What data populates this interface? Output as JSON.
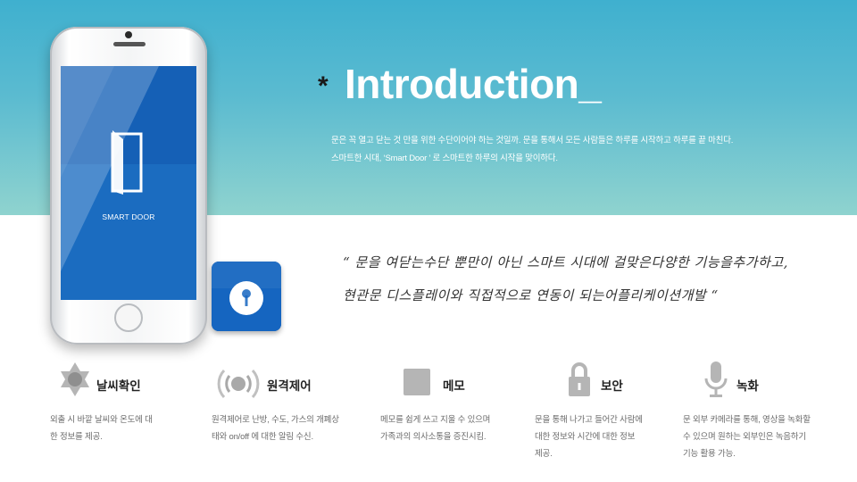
{
  "header": {
    "title": "Introduction_",
    "asterisk": "*",
    "intro_line1": "문은 꼭 열고 닫는 것 만을 위한 수단이어야 하는 것일까. 문을 통해서 모든 사람들은 하루를 시작하고 하루를 끝 마친다.",
    "intro_line2": "스마트한 시대, ‘Smart Door ’ 로 스마트한 하루의 시작을 맞이하다."
  },
  "phone": {
    "screen_label": "SMART DOOR"
  },
  "quote": {
    "line1": "“ 문을 여닫는수단 뿐만이 아닌 스마트 시대에 걸맞은다양한 기능을추가하고,",
    "line2": "현관문 디스플레이와 직접적으로 연동이 되는어플리케이션개발 “"
  },
  "features": [
    {
      "title": "날씨확인",
      "icon": "sun-icon",
      "desc_line1": "외출 시 바깥 날씨와 온도에 대",
      "desc_line2": "한 정보를 제공.",
      "desc_line3": ""
    },
    {
      "title": "원격제어",
      "icon": "signal-icon",
      "desc_line1": "원격제어로 난방, 수도, 가스의 개폐상",
      "desc_line2": "태와 on/off 에 대한 알림 수신.",
      "desc_line3": ""
    },
    {
      "title": "메모",
      "icon": "memo-icon",
      "desc_line1": "메모를 쉽게 쓰고 지울 수 있으며",
      "desc_line2": "가족과의 의사소통을 증진시킴.",
      "desc_line3": ""
    },
    {
      "title": "보안",
      "icon": "lock-icon",
      "desc_line1": "문을 통해 나가고 들어간 사람에",
      "desc_line2": "대한 정보와 시간에 대한 정보",
      "desc_line3": "제공."
    },
    {
      "title": "녹화",
      "icon": "microphone-icon",
      "desc_line1": "문 외부 카메라를 통해, 영상을 녹화할",
      "desc_line2": " 수 있으며 원하는 외부인은 녹음하기",
      "desc_line3": "기능 활용 가능."
    }
  ],
  "colors": {
    "band_top": "#3fb0cf",
    "band_bottom": "#8fd3cf",
    "screen_blue": "#1560b6",
    "app_icon_blue": "#1565c0",
    "icon_gray": "#b5b5b5"
  }
}
